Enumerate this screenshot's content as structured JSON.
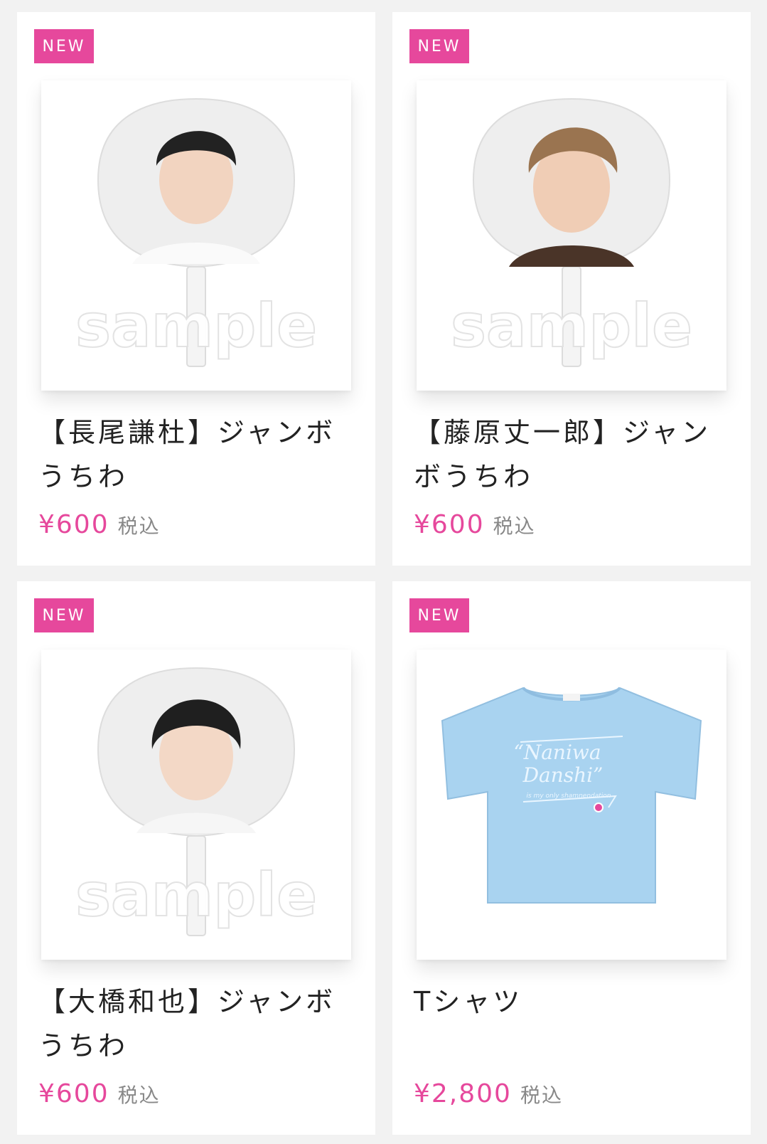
{
  "products": [
    {
      "badge": "NEW",
      "title": "【長尾謙杜】ジャンボうちわ",
      "price": "¥600",
      "tax_note": "税込",
      "watermark": "sample",
      "image": "jumbo-uchiwa-photo"
    },
    {
      "badge": "NEW",
      "title": "【藤原丈一郎】ジャンボうちわ",
      "price": "¥600",
      "tax_note": "税込",
      "watermark": "sample",
      "image": "jumbo-uchiwa-photo"
    },
    {
      "badge": "NEW",
      "title": "【大橋和也】ジャンボうちわ",
      "price": "¥600",
      "tax_note": "税込",
      "watermark": "sample",
      "image": "jumbo-uchiwa-photo"
    },
    {
      "badge": "NEW",
      "title": "Tシャツ",
      "price": "¥2,800",
      "tax_note": "税込",
      "shirt_print": [
        "“Naniwa",
        "Danshi”",
        "is my only shamnendation"
      ],
      "image": "light-blue-tshirt"
    }
  ],
  "colors": {
    "accent": "#e6489c",
    "tshirt": "#a9d3f0",
    "background": "#f2f2f2"
  }
}
